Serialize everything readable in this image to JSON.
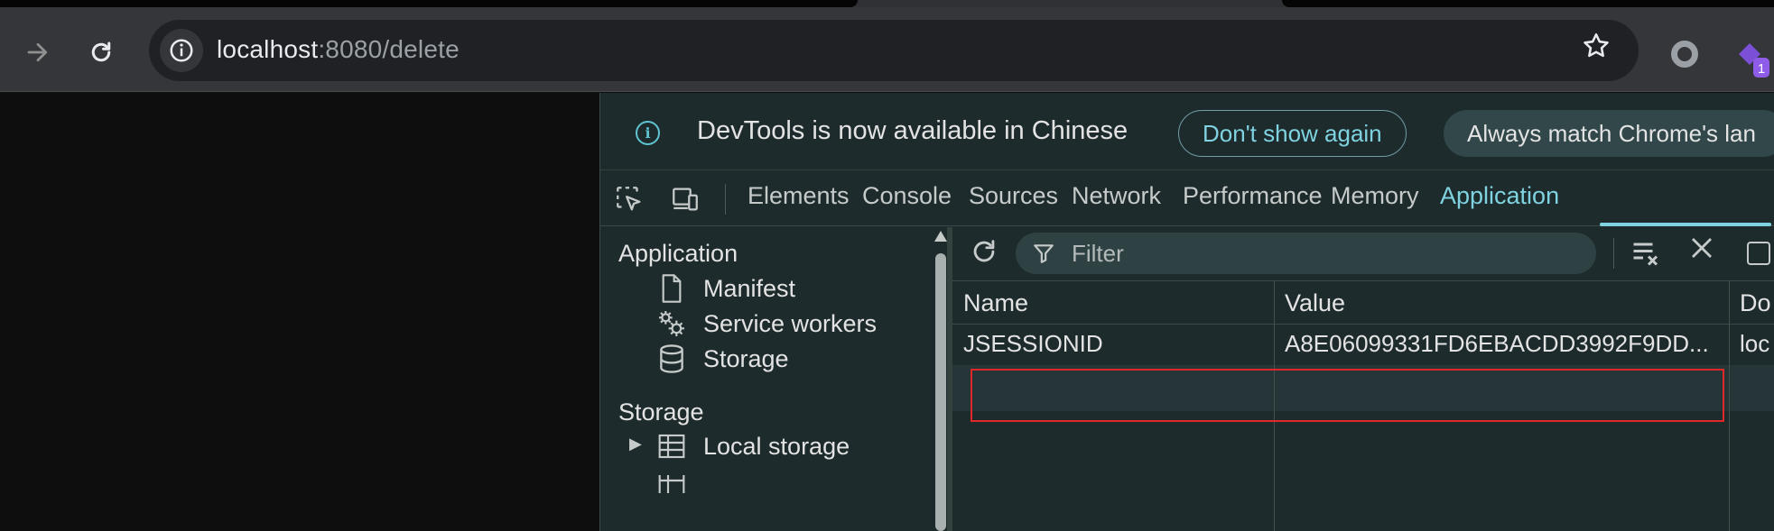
{
  "browser": {
    "url_host": "localhost",
    "url_rest": ":8080/delete",
    "icons": {
      "forward": "arrow-right-icon",
      "reload": "reload-icon",
      "site_info": "info-icon",
      "bookmark": "star-icon",
      "extension": "circle-extension-icon",
      "profile": "extension-badge-icon"
    },
    "badge_count": "1"
  },
  "devtools": {
    "infobar": {
      "message": "DevTools is now available in Chinese",
      "dont_show": "Don't show again",
      "always_match": "Always match Chrome's lan"
    },
    "tabs": [
      {
        "label": "Elements"
      },
      {
        "label": "Console"
      },
      {
        "label": "Sources"
      },
      {
        "label": "Network"
      },
      {
        "label": "Performance"
      },
      {
        "label": "Memory"
      },
      {
        "label": "Application"
      }
    ],
    "active_tab": "Application",
    "sidebar": {
      "application_heading": "Application",
      "application_items": [
        {
          "label": "Manifest",
          "icon": "document-icon"
        },
        {
          "label": "Service workers",
          "icon": "gears-icon"
        },
        {
          "label": "Storage",
          "icon": "database-icon"
        }
      ],
      "storage_heading": "Storage",
      "storage_items": [
        {
          "label": "Local storage",
          "icon": "table-icon"
        }
      ]
    },
    "cookies": {
      "filter_placeholder": "Filter",
      "columns": [
        "Name",
        "Value",
        "Do"
      ],
      "rows": [
        {
          "name": "JSESSIONID",
          "value": "A8E06099331FD6EBACDD3992F9DD...",
          "domain": "loc"
        }
      ]
    },
    "colors": {
      "accent": "#7fd3e0",
      "panel_bg": "#1e2b2d",
      "highlight": "#e0282b"
    }
  }
}
